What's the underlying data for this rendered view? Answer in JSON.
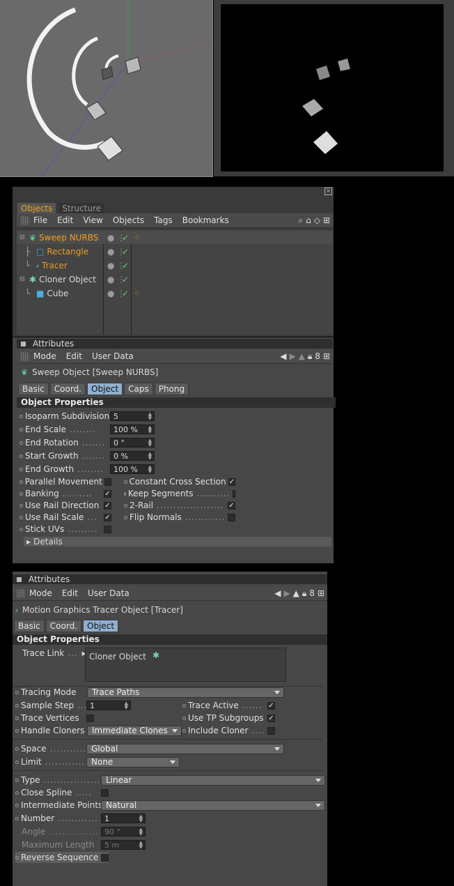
{
  "object_manager": {
    "tabs": [
      "Objects",
      "Structure"
    ],
    "menu": [
      "File",
      "Edit",
      "View",
      "Objects",
      "Tags",
      "Bookmarks"
    ],
    "objects": [
      {
        "name": "Sweep NURBS",
        "color": "#f0a020",
        "level": 0
      },
      {
        "name": "Rectangle",
        "color": "#e49a25",
        "level": 1
      },
      {
        "name": "Tracer",
        "color": "#e49a25",
        "level": 1
      },
      {
        "name": "Cloner Object",
        "color": "#d8d8d8",
        "level": 0
      },
      {
        "name": "Cube",
        "color": "#d8d8d8",
        "level": 1
      }
    ]
  },
  "attr1": {
    "title": "Attributes",
    "menu": [
      "Mode",
      "Edit",
      "User Data"
    ],
    "object_title": "Sweep Object [Sweep NURBS]",
    "tabs": [
      "Basic",
      "Coord.",
      "Object",
      "Caps",
      "Phong"
    ],
    "active_tab": "Object",
    "section": "Object Properties",
    "fields": [
      {
        "label": "Isoparm Subdivision",
        "value": "5"
      },
      {
        "label": "End Scale",
        "value": "100 %"
      },
      {
        "label": "End Rotation",
        "value": "0 °"
      },
      {
        "label": "Start Growth",
        "value": "0 %"
      },
      {
        "label": "End Growth",
        "value": "100 %"
      }
    ],
    "checks_left": [
      {
        "label": "Parallel Movement",
        "checked": false
      },
      {
        "label": "Banking",
        "checked": true
      },
      {
        "label": "Use Rail Direction",
        "checked": true
      },
      {
        "label": "Use Rail Scale",
        "checked": true
      },
      {
        "label": "Stick UVs",
        "checked": false
      }
    ],
    "checks_right": [
      {
        "label": "Constant Cross Section",
        "checked": true
      },
      {
        "label": "Keep Segments",
        "checked": false
      },
      {
        "label": "2-Rail",
        "checked": true
      },
      {
        "label": "Flip Normals",
        "checked": false
      }
    ],
    "details": "Details"
  },
  "attr2": {
    "title": "Attributes",
    "menu": [
      "Mode",
      "Edit",
      "User Data"
    ],
    "object_title": "Motion Graphics Tracer Object [Tracer]",
    "tabs": [
      "Basic",
      "Coord.",
      "Object"
    ],
    "active_tab": "Object",
    "section": "Object Properties",
    "trace_link_label": "Trace Link",
    "trace_link_value": "Cloner Object",
    "tracing_mode_label": "Tracing Mode",
    "tracing_mode_value": "Trace Paths",
    "sample_step_label": "Sample Step",
    "sample_step_value": "1",
    "trace_active_label": "Trace Active",
    "trace_vertices_label": "Trace Vertices",
    "use_tp_label": "Use TP Subgroups",
    "handle_cloners_label": "Handle Cloners",
    "handle_cloners_value": "Immediate Clones",
    "include_cloner_label": "Include Cloner",
    "space_label": "Space",
    "space_value": "Global",
    "limit_label": "Limit",
    "limit_value": "None",
    "type_label": "Type",
    "type_value": "Linear",
    "close_spline_label": "Close Spline",
    "intermediate_label": "Intermediate Points",
    "intermediate_value": "Natural",
    "number_label": "Number",
    "number_value": "1",
    "angle_label": "Angle",
    "angle_value": "90 °",
    "maxlen_label": "Maximum Length",
    "maxlen_value": "5 m",
    "reverse_label": "Reverse Sequence"
  }
}
